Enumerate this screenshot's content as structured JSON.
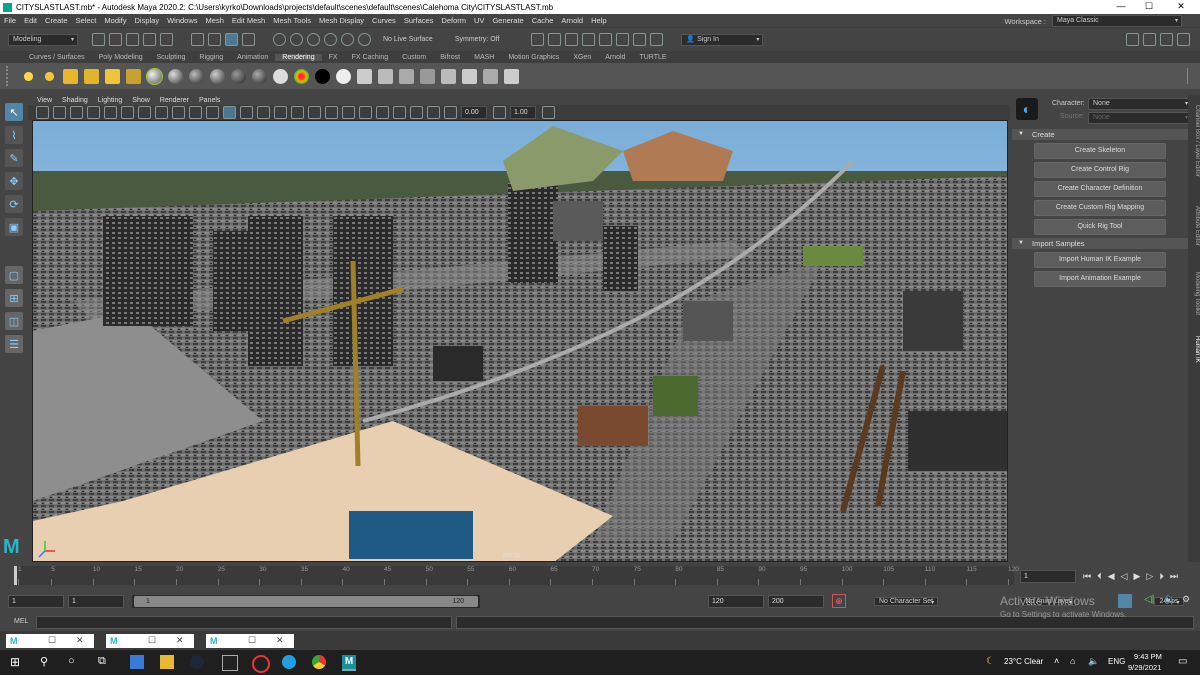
{
  "window": {
    "title": "CITYSLASTLAST.mb* - Autodesk Maya 2020.2: C:\\Users\\kyrko\\Downloads\\projects\\default\\scenes\\default\\scenes\\Calehoma City\\CITYSLASTLAST.mb",
    "min": "—",
    "max": "☐",
    "close": "✕"
  },
  "menubar": {
    "items": [
      "File",
      "Edit",
      "Create",
      "Select",
      "Modify",
      "Display",
      "Windows",
      "Mesh",
      "Edit Mesh",
      "Mesh Tools",
      "Mesh Display",
      "Curves",
      "Surfaces",
      "Deform",
      "UV",
      "Generate",
      "Cache",
      "Arnold",
      "Help"
    ],
    "workspace_label": "Workspace :",
    "workspace_value": "Maya Classic"
  },
  "statusline": {
    "mode": "Modeling",
    "live_surface": "No Live Surface",
    "symmetry": "Symmetry: Off",
    "sign_in": "Sign In"
  },
  "shelf": {
    "tabs": [
      "Curves / Surfaces",
      "Poly Modeling",
      "Sculpting",
      "Rigging",
      "Animation",
      "Rendering",
      "FX",
      "FX Caching",
      "Custom",
      "Bifrost",
      "MASH",
      "Motion Graphics",
      "XGen",
      "Arnold",
      "TURTLE"
    ],
    "active_tab": "Rendering"
  },
  "viewport": {
    "menus": [
      "View",
      "Shading",
      "Lighting",
      "Show",
      "Renderer",
      "Panels"
    ],
    "value_a": "0.00",
    "value_b": "1.00",
    "camera_label": "persp"
  },
  "hik": {
    "character_label": "Character:",
    "character_value": "None",
    "source_label": "Source:",
    "source_value": "None",
    "create_header": "Create",
    "create_buttons": [
      "Create Skeleton",
      "Create Control Rig",
      "Create Character Definition",
      "Create Custom Rig Mapping",
      "Quick Rig Tool"
    ],
    "import_header": "Import Samples",
    "import_buttons": [
      "Import Human IK Example",
      "Import Animation Example"
    ]
  },
  "side_tabs": [
    "Channel Box / Layer Editor",
    "Attribute Editor",
    "Modeling Toolkit",
    "Human IK"
  ],
  "timeline": {
    "ticks": [
      "1",
      "5",
      "10",
      "15",
      "20",
      "25",
      "30",
      "35",
      "40",
      "45",
      "50",
      "55",
      "60",
      "65",
      "70",
      "75",
      "80",
      "85",
      "90",
      "95",
      "100",
      "105",
      "110",
      "115",
      "120"
    ],
    "current_frame": "1"
  },
  "range": {
    "start": "1",
    "start_inner": "1",
    "slider_start": "1",
    "slider_end": "120",
    "end_inner": "120",
    "end": "200",
    "character_set": "No Character Set",
    "anim_layer": "No Anim Layer",
    "fps": "24 fps"
  },
  "cmdline": {
    "label": "MEL"
  },
  "activate": {
    "line1": "Activate Windows",
    "line2": "Go to Settings to activate Windows."
  },
  "taskbar": {
    "weather": "23°C  Clear",
    "lang": "ENG",
    "time": "9:43 PM",
    "date": "9/29/2021"
  },
  "colors": {
    "accent": "#5285a6",
    "sky": "#7aaed8",
    "ground": "#6b6b6b"
  }
}
